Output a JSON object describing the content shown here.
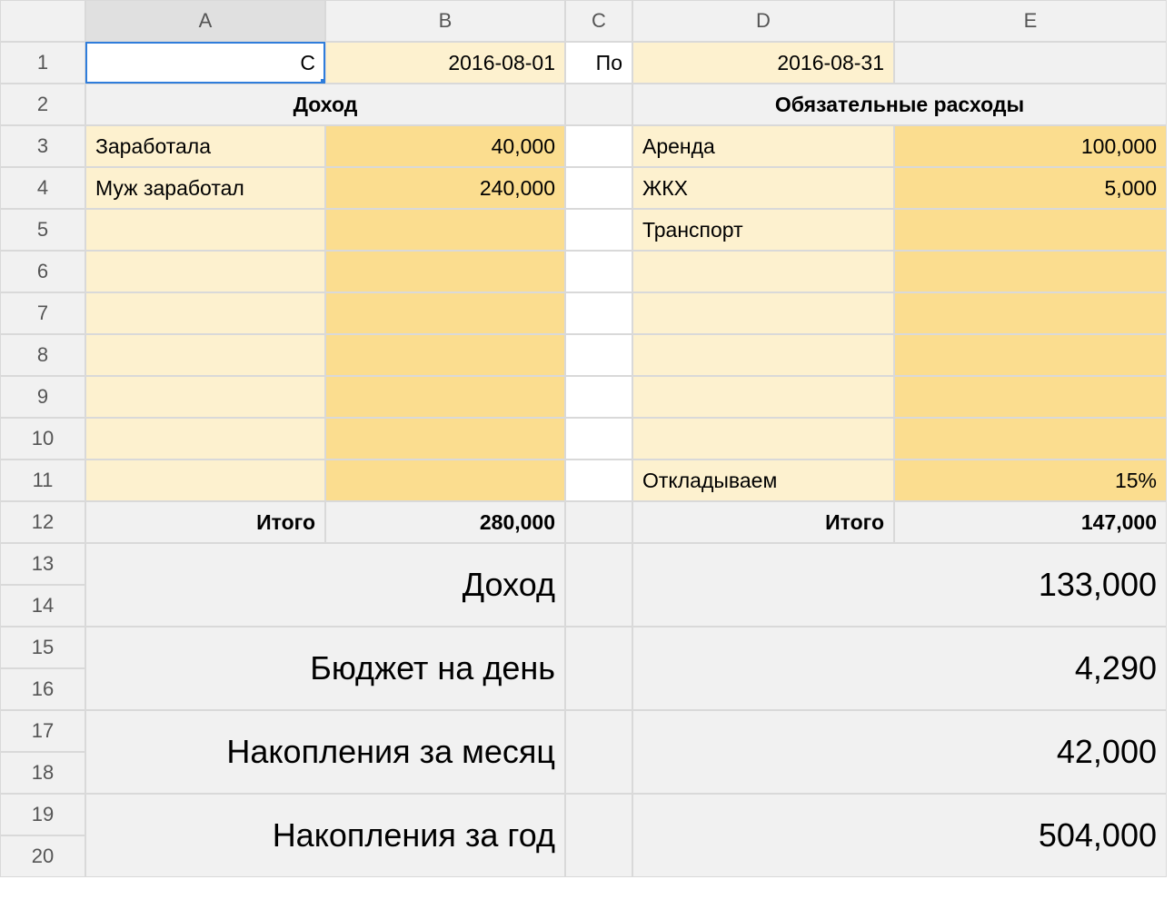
{
  "columns": [
    "A",
    "B",
    "C",
    "D",
    "E"
  ],
  "rowcount": 20,
  "row1": {
    "A": "С",
    "B": "2016-08-01",
    "C": "По",
    "D": "2016-08-31",
    "E": ""
  },
  "row2": {
    "income_hdr": "Доход",
    "expense_hdr": "Обязательные расходы"
  },
  "income": {
    "rows": [
      {
        "label": "Заработала",
        "value": "40,000"
      },
      {
        "label": "Муж заработал",
        "value": "240,000"
      },
      {
        "label": "",
        "value": ""
      },
      {
        "label": "",
        "value": ""
      },
      {
        "label": "",
        "value": ""
      },
      {
        "label": "",
        "value": ""
      },
      {
        "label": "",
        "value": ""
      },
      {
        "label": "",
        "value": ""
      },
      {
        "label": "",
        "value": ""
      }
    ],
    "total_label": "Итого",
    "total_value": "280,000"
  },
  "expenses": {
    "rows": [
      {
        "label": "Аренда",
        "value": "100,000"
      },
      {
        "label": "ЖКХ",
        "value": "5,000"
      },
      {
        "label": "Транспорт",
        "value": ""
      },
      {
        "label": "",
        "value": ""
      },
      {
        "label": "",
        "value": ""
      },
      {
        "label": "",
        "value": ""
      },
      {
        "label": "",
        "value": ""
      },
      {
        "label": "",
        "value": ""
      },
      {
        "label": "Откладываем",
        "value": "15%"
      }
    ],
    "total_label": "Итого",
    "total_value": "147,000"
  },
  "summary": [
    {
      "label": "Доход",
      "value": "133,000"
    },
    {
      "label": "Бюджет на день",
      "value": "4,290"
    },
    {
      "label": "Накопления за месяц",
      "value": "42,000"
    },
    {
      "label": "Накопления за год",
      "value": "504,000"
    }
  ]
}
